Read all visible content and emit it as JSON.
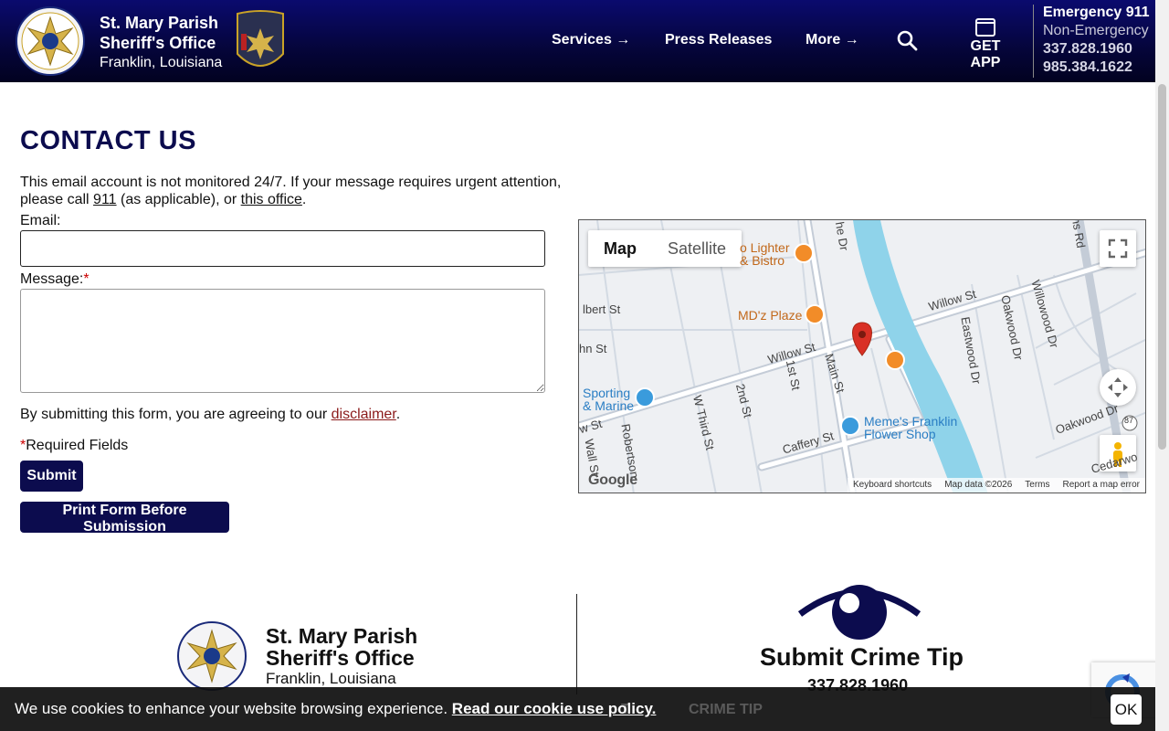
{
  "header": {
    "brand_line1": "St. Mary Parish",
    "brand_line2": "Sheriff's Office",
    "brand_line3": "Franklin, Louisiana",
    "nav": {
      "services": "Services →",
      "press": "Press Releases",
      "more": "More →"
    },
    "get_app": "GET APP",
    "emergency_label": "Emergency 911",
    "non_emergency_label": "Non-Emergency",
    "phone1": "337.828.1960",
    "phone2": "985.384.1622"
  },
  "main": {
    "title": "CONTACT US",
    "notice_pre": "This email account is not monitored 24/7. If your message requires urgent attention, please call ",
    "notice_link1": "911",
    "notice_mid": " (as applicable), or ",
    "notice_link2": "this office",
    "notice_end": ".",
    "email_label": "Email:",
    "email_value": "",
    "message_label": "Message:",
    "required_mark": "*",
    "message_value": "",
    "agree_pre": "By submitting this form, you are agreeing to our ",
    "agree_link": "disclaimer",
    "agree_end": ".",
    "required_note": "Required Fields",
    "submit_label": "Submit",
    "print_label": "Print Form Before Submission"
  },
  "map": {
    "tab_map": "Map",
    "tab_satellite": "Satellite",
    "streets": [
      "lbert St",
      "hn St",
      "Willow St",
      "Willow St",
      "Main St",
      "1st St",
      "2nd St",
      "W Third St",
      "Robertson",
      "Caffery St",
      "Eastwood Dr",
      "Oakwood Dr",
      "Willowood Dr",
      "Oakwood Dr",
      "Cedarwo",
      "w St",
      "Wall St",
      "he Dr",
      "ns Rd"
    ],
    "pois": [
      "o Lighter",
      "& Bistro",
      "MD'z Plaze",
      "Sporting",
      "& Marine",
      "Meme's Franklin",
      "Flower Shop"
    ],
    "route": "87",
    "google": "Google",
    "attrib": [
      "Keyboard shortcuts",
      "Map data ©2026",
      "Terms",
      "Report a map error"
    ]
  },
  "footer": {
    "brand_line1": "St. Mary Parish",
    "brand_line2": "Sheriff's Office",
    "brand_line3": "Franklin, Louisiana",
    "tip_title": "Submit Crime Tip",
    "tip_phone": "337.828.1960",
    "ghost_crime_tip": "CRIME TIP",
    "ghost_t": "T"
  },
  "cookie": {
    "text": "We use cookies to enhance your website browsing experience. ",
    "link": "Read our cookie use policy.",
    "ok": "OK"
  },
  "colors": {
    "navy": "#0c0c4e",
    "link_red": "#8b1a1a",
    "required_red": "#cc0000",
    "map_water": "#8fd3ea",
    "poi_orange": "#f28c28",
    "poi_blue": "#3a9bdc",
    "pin_red": "#d93025"
  }
}
